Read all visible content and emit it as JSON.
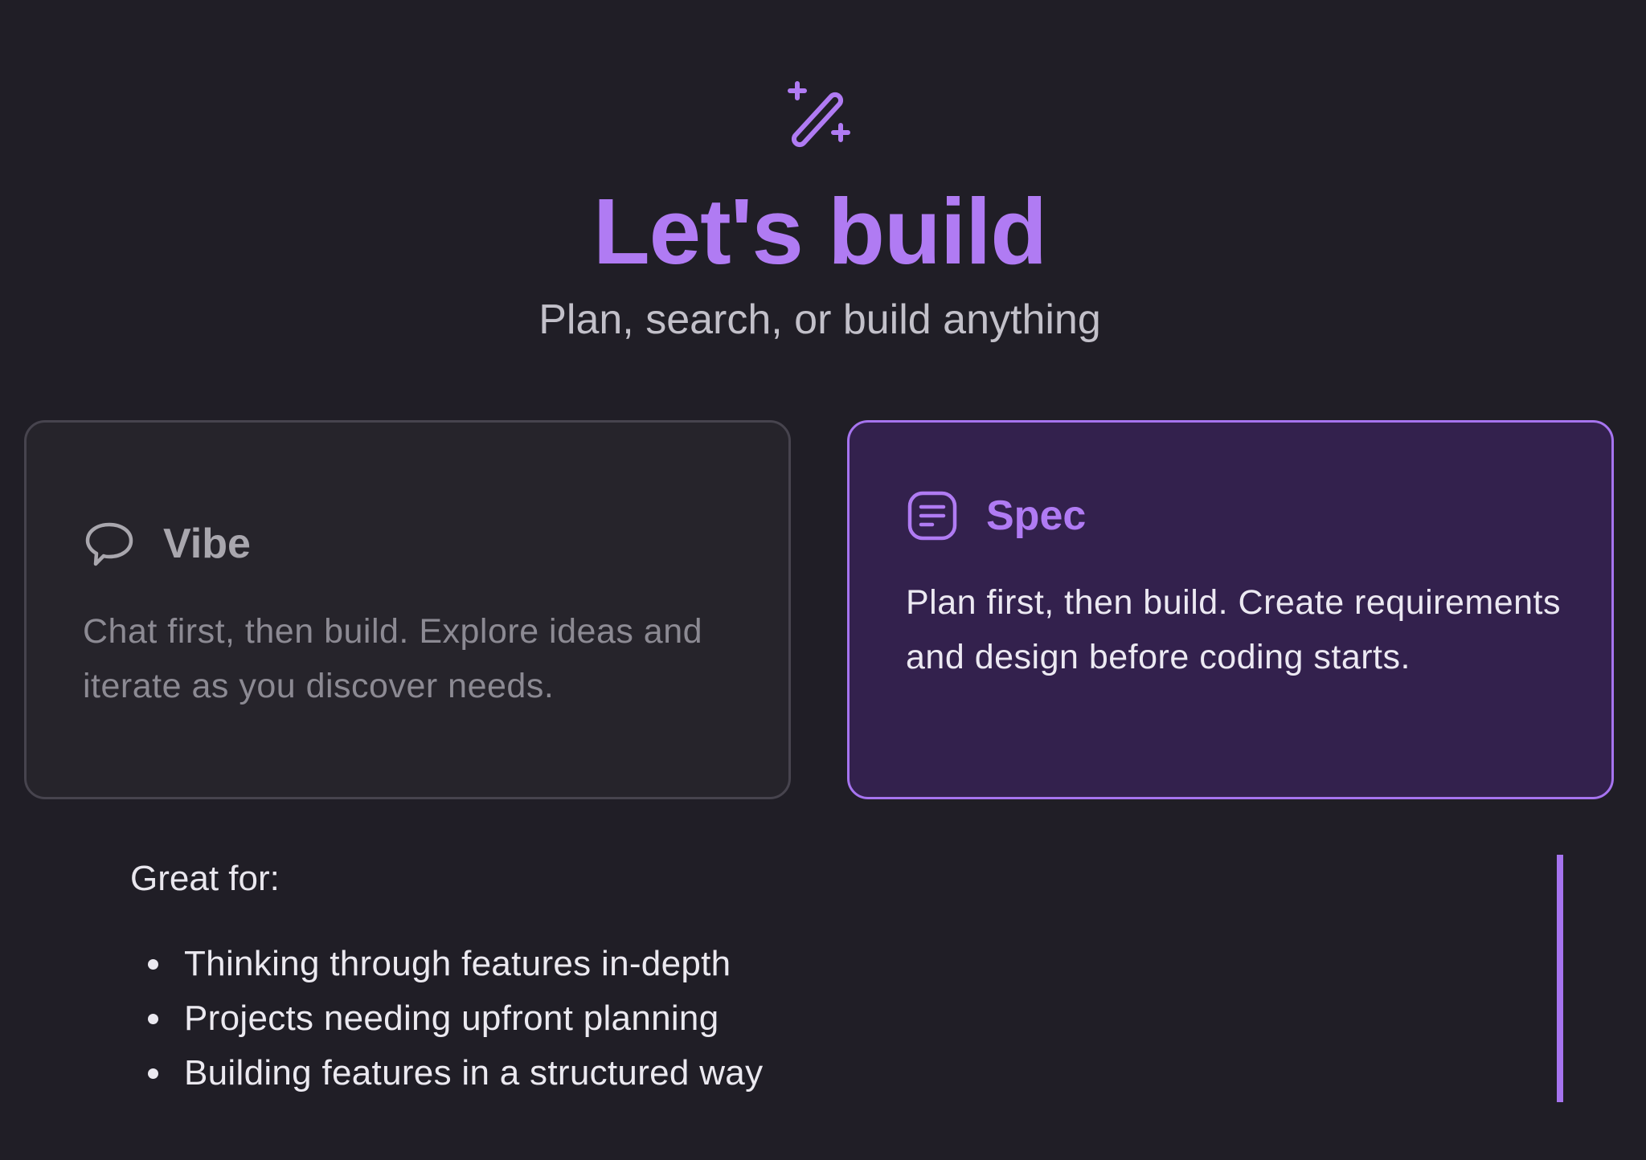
{
  "header": {
    "icon": "magic-wand-icon",
    "title": "Let's build",
    "subtitle": "Plan, search, or build anything"
  },
  "modes": [
    {
      "id": "vibe",
      "icon": "chat-bubble-icon",
      "name": "Vibe",
      "description": "Chat first, then build. Explore ideas and iterate as you discover needs.",
      "selected": false
    },
    {
      "id": "spec",
      "icon": "document-lines-icon",
      "name": "Spec",
      "description": "Plan first, then build. Create requirements and design before coding starts.",
      "selected": true
    }
  ],
  "details": {
    "label": "Great for:",
    "items": [
      "Thinking through features in-depth",
      "Projects needing upfront planning",
      "Building features in a structured way"
    ]
  },
  "colors": {
    "background": "#201e26",
    "accent": "#b07bf3",
    "selected_card_bg": "#33214d",
    "card_bg": "#26242b"
  }
}
